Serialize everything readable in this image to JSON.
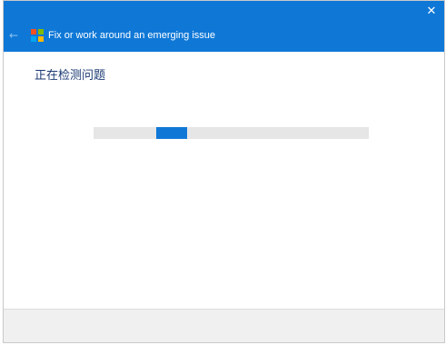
{
  "window": {
    "title": "Fix or work around an emerging issue",
    "accent_color": "#0f78d7",
    "back_icon": "back-arrow-icon",
    "app_icon": "windows-logo-icon",
    "close_icon": "close-icon",
    "close_glyph": "✕",
    "back_glyph": "←"
  },
  "main": {
    "heading": "正在检测问题",
    "progress": {
      "indeterminate": true,
      "chunk_start": 0.228,
      "chunk_end": 0.34
    }
  }
}
